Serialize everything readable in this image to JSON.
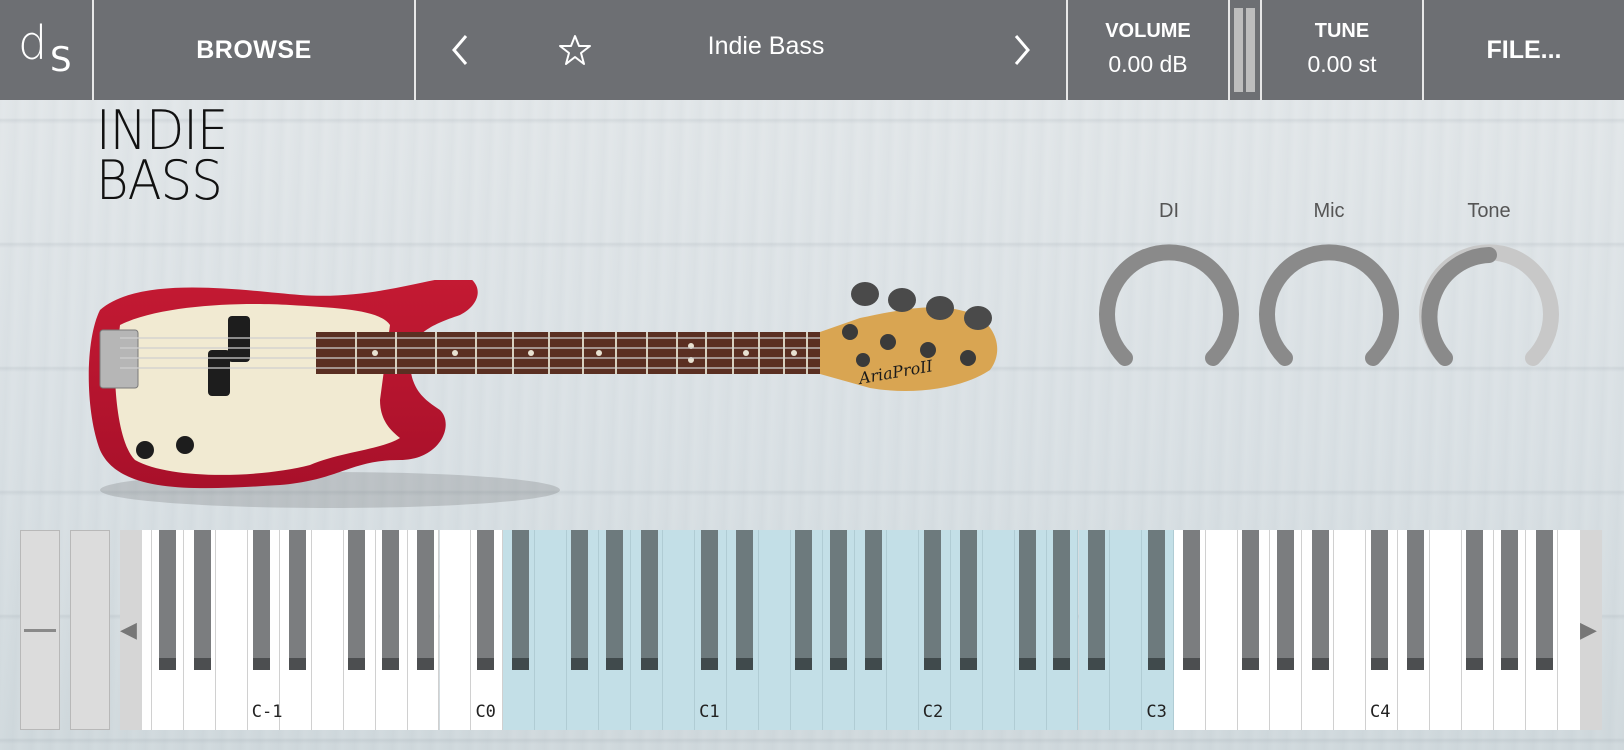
{
  "header": {
    "logo_d": "d",
    "logo_s": "S",
    "browse_label": "BROWSE",
    "preset_name": "Indie Bass",
    "volume_label": "VOLUME",
    "volume_value": "0.00 dB",
    "tune_label": "TUNE",
    "tune_value": "0.00 st",
    "file_label": "FILE..."
  },
  "instrument": {
    "title_line1": "INDIE",
    "title_line2": "BASS",
    "guitar_headstock_text": "AriaProII"
  },
  "knobs": [
    {
      "label": "DI"
    },
    {
      "label": "Mic"
    },
    {
      "label": "Tone"
    }
  ],
  "keyboard": {
    "octave_labels": [
      "C-1",
      "C0",
      "C1",
      "C2",
      "C3",
      "C4"
    ],
    "highlight_color": "#c3dfe7"
  },
  "colors": {
    "topbar": "#6d6f73",
    "knob_active": "#8a8a8a",
    "knob_inactive": "#c4c4c4"
  }
}
